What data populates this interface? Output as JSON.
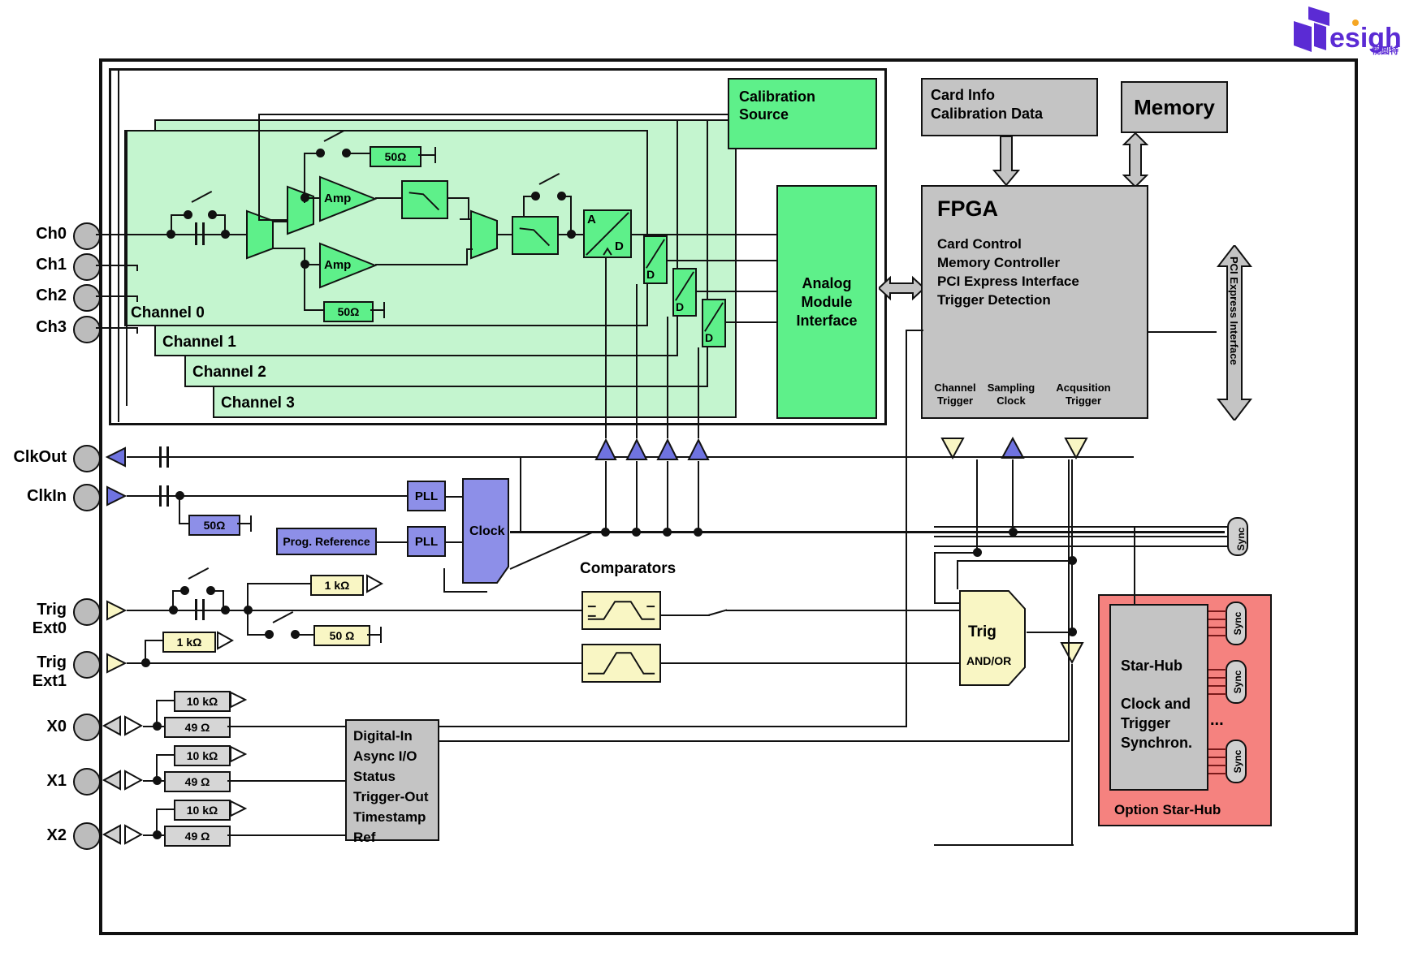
{
  "logo": {
    "text": "esight",
    "cn": "视圆特",
    "color": "#5B2BD4"
  },
  "outer_frame": {
    "label": ""
  },
  "ports": {
    "analog_inputs": [
      "Ch0",
      "Ch1",
      "Ch2",
      "Ch3"
    ],
    "clock": [
      "ClkOut",
      "ClkIn"
    ],
    "triggers": [
      "Trig Ext0",
      "Trig Ext1"
    ],
    "digital": [
      "X0",
      "X1",
      "X2"
    ]
  },
  "channels": {
    "labels": [
      "Channel 0",
      "Channel 1",
      "Channel 2",
      "Channel 3"
    ],
    "amp_label": "Amp",
    "adc_a": "A",
    "adc_d": "D",
    "term_50": "50Ω"
  },
  "blocks": {
    "calibration_source": "Calibration\nSource",
    "calibration_source_lines": [
      "Calibration",
      "Source"
    ],
    "card_info": [
      "Card Info",
      "Calibration Data"
    ],
    "memory": "Memory",
    "analog_module_interface": [
      "Analog",
      "Module",
      "Interface"
    ],
    "fpga": {
      "title": "FPGA",
      "features": [
        "Card Control",
        "Memory Controller",
        "PCI Express Interface",
        "Trigger Detection"
      ],
      "ports": [
        [
          "Channel",
          "Trigger"
        ],
        [
          "Sampling",
          "Clock"
        ],
        [
          "Acqusition",
          "Trigger"
        ]
      ]
    },
    "pci_express_interface": "PCI Express Interface",
    "clock_block": "Clock",
    "pll": "PLL",
    "prog_reference": "Prog. Reference",
    "comparators": "Comparators",
    "trig": {
      "title": "Trig",
      "mode": "AND/OR"
    },
    "star_hub": {
      "title": "Star-Hub",
      "lines": [
        "Clock and",
        "Trigger",
        "Synchron."
      ],
      "option_label": "Option Star-Hub",
      "sync_label": "Sync",
      "ellipsis": "..."
    },
    "digital_in": [
      "Digital-In",
      "Async I/O",
      "Status",
      "Trigger-Out",
      "Timestamp",
      "Ref"
    ]
  },
  "resistors": {
    "r50_ohm": "50Ω",
    "r50_ohm_sp": "50 Ω",
    "r1k": "1 kΩ",
    "r10k": "10 kΩ",
    "r49": "49 Ω"
  },
  "colors": {
    "green_dark": "#5ef08a",
    "green_light": "#c4f5cf",
    "grey": "#c4c4c4",
    "blue": "#8d8fe8",
    "yellow": "#f9f6c4",
    "red": "#f5827f",
    "outline": "#111111"
  }
}
